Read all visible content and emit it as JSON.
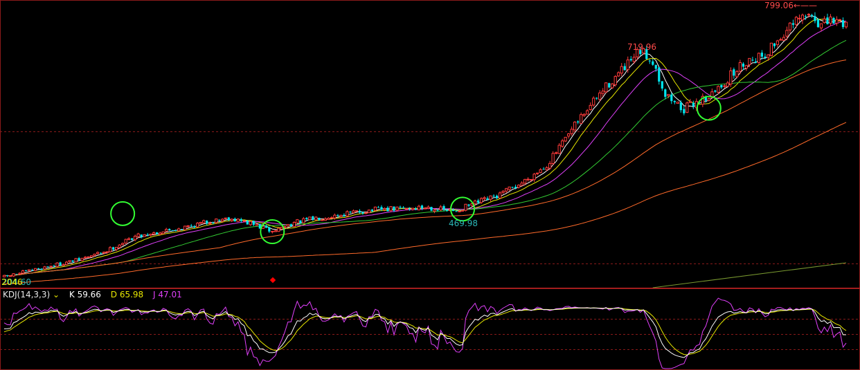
{
  "chart_data": {
    "type": "candlestick",
    "colors": {
      "background": "#000000",
      "up": "#ff3b3b",
      "down": "#00e5ee",
      "ma_white": "#ffffff",
      "ma_yellow": "#e8e800",
      "ma_magenta": "#e040fb",
      "ma_green": "#33cc33",
      "ma_orange": "#ff6a2a",
      "ma_olive": "#7a9a30",
      "grid": "#8b1a1a",
      "kdj_k": "#ffffff",
      "kdj_d": "#e8e800",
      "kdj_j": "#e040fb",
      "highlight_circle": "#33ff33",
      "marker": "#ff0000"
    },
    "price_ylim": [
      205,
      812
    ],
    "annotations": {
      "high_label": "799.06",
      "peak_label": "719.96",
      "trough_label": "469.98",
      "low_label": "204.60",
      "low_label_overlap": "2046"
    },
    "price_anchors": [
      {
        "i": 0,
        "p": 212
      },
      {
        "i": 12,
        "p": 232
      },
      {
        "i": 24,
        "p": 250
      },
      {
        "i": 33,
        "p": 270
      },
      {
        "i": 42,
        "p": 302
      },
      {
        "i": 50,
        "p": 312
      },
      {
        "i": 58,
        "p": 322
      },
      {
        "i": 66,
        "p": 335
      },
      {
        "i": 72,
        "p": 343
      },
      {
        "i": 80,
        "p": 328
      },
      {
        "i": 86,
        "p": 312
      },
      {
        "i": 92,
        "p": 330
      },
      {
        "i": 100,
        "p": 342
      },
      {
        "i": 110,
        "p": 352
      },
      {
        "i": 118,
        "p": 360
      },
      {
        "i": 126,
        "p": 362
      },
      {
        "i": 136,
        "p": 366
      },
      {
        "i": 144,
        "p": 356
      },
      {
        "i": 150,
        "p": 372
      },
      {
        "i": 158,
        "p": 390
      },
      {
        "i": 166,
        "p": 420
      },
      {
        "i": 174,
        "p": 460
      },
      {
        "i": 180,
        "p": 515
      },
      {
        "i": 186,
        "p": 575
      },
      {
        "i": 194,
        "p": 640
      },
      {
        "i": 200,
        "p": 680
      },
      {
        "i": 204,
        "p": 710
      },
      {
        "i": 208,
        "p": 690
      },
      {
        "i": 212,
        "p": 615
      },
      {
        "i": 218,
        "p": 582
      },
      {
        "i": 222,
        "p": 600
      },
      {
        "i": 227,
        "p": 615
      },
      {
        "i": 232,
        "p": 650
      },
      {
        "i": 238,
        "p": 690
      },
      {
        "i": 244,
        "p": 705
      },
      {
        "i": 250,
        "p": 750
      },
      {
        "i": 256,
        "p": 785
      },
      {
        "i": 259,
        "p": 790
      },
      {
        "i": 262,
        "p": 768
      },
      {
        "i": 266,
        "p": 778
      },
      {
        "i": 270,
        "p": 774
      }
    ],
    "kdj_legend": {
      "title": "KDJ(14,3,3)",
      "arrow": "⌄",
      "k_label": "K 59.66",
      "d_label": "D 65.98",
      "j_label": "J 47.01"
    },
    "kdj_ylim": [
      -15,
      115
    ]
  }
}
